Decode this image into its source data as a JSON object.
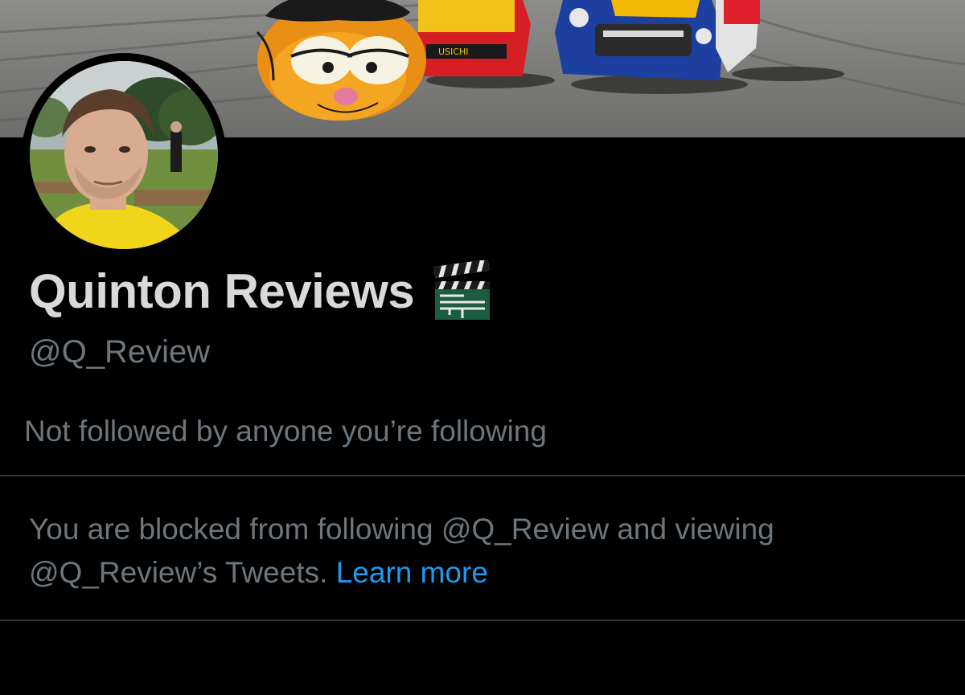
{
  "profile": {
    "display_name": "Quinton Reviews",
    "handle": "@Q_Review",
    "name_emoji": "clapper-board-icon",
    "followed_by_text": "Not followed by anyone you’re following"
  },
  "blocked": {
    "message_line1": "You are blocked from following @Q_Review and viewing",
    "message_line2": "@Q_Review’s Tweets.",
    "link_label": "Learn more"
  },
  "colors": {
    "background": "#000000",
    "primary_text": "#d9d9d9",
    "secondary_text": "#6e767d",
    "link": "#1d9bf0",
    "divider": "#2f3336"
  }
}
